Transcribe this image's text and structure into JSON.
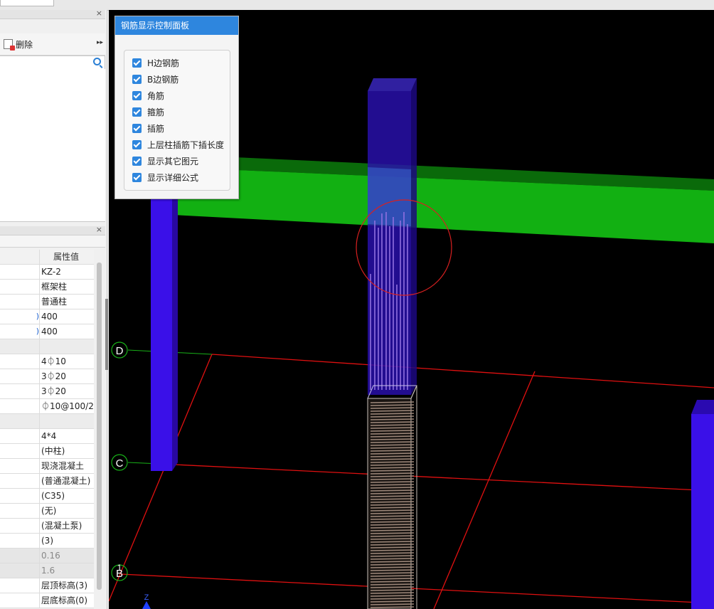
{
  "left_panel": {
    "toolbar": {
      "delete_label": "删除",
      "more_glyph": "▸▸"
    },
    "close_glyph": "×",
    "properties": {
      "header_value": "属性值",
      "rows": [
        {
          "name": "",
          "value": "KZ-2"
        },
        {
          "name": "",
          "value": "框架柱"
        },
        {
          "name": "",
          "value": "普通柱"
        },
        {
          "name": ")",
          "value": "400"
        },
        {
          "name": ")",
          "value": "400"
        },
        {
          "name": "",
          "value": ""
        },
        {
          "name": "",
          "value": "4⏀10"
        },
        {
          "name": "",
          "value": "3⏀20"
        },
        {
          "name": "",
          "value": "3⏀20"
        },
        {
          "name": "",
          "value": "⏀10@100/2"
        },
        {
          "name": "",
          "value": ""
        },
        {
          "name": "",
          "value": "4*4"
        },
        {
          "name": "",
          "value": "(中柱)"
        },
        {
          "name": "",
          "value": "现浇混凝土"
        },
        {
          "name": "",
          "value": "(普通混凝土)"
        },
        {
          "name": "",
          "value": "(C35)"
        },
        {
          "name": "",
          "value": "(无)"
        },
        {
          "name": "",
          "value": "(混凝土泵)"
        },
        {
          "name": "",
          "value": "(3)"
        },
        {
          "name": "",
          "value": "0.16"
        },
        {
          "name": "",
          "value": "1.6"
        },
        {
          "name": "",
          "value": "层顶标高(3)"
        },
        {
          "name": "",
          "value": "层底标高(0)"
        }
      ]
    }
  },
  "dialog": {
    "title": "钢筋显示控制面板",
    "options": [
      {
        "label": "H边钢筋",
        "checked": true
      },
      {
        "label": "B边钢筋",
        "checked": true
      },
      {
        "label": "角筋",
        "checked": true
      },
      {
        "label": "箍筋",
        "checked": true
      },
      {
        "label": "插筋",
        "checked": true
      },
      {
        "label": "上层柱插筋下插长度",
        "checked": true
      },
      {
        "label": "显示其它图元",
        "checked": true
      },
      {
        "label": "显示详细公式",
        "checked": true
      }
    ]
  },
  "viewport": {
    "axis_labels": {
      "d": "D",
      "c": "C",
      "b": "B",
      "one": "1",
      "z": "Z"
    },
    "colors": {
      "background": "#000000",
      "column": "#3a10e8",
      "beam": "#12b012",
      "grid": "#e01010",
      "axis_circle": "#18b018",
      "highlight_circle": "#d82020",
      "rebar": "#9070e0",
      "stirrup": "#a08a7c"
    }
  },
  "colors": {
    "accent": "#2e86de"
  }
}
